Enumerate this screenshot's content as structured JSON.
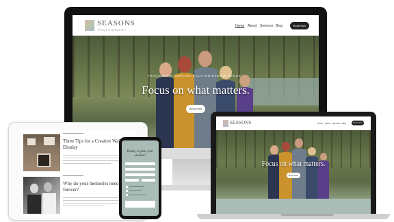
{
  "site": {
    "brand": "SEASONS",
    "brand_sub": "PHOTOGRAPHY",
    "nav": [
      "Home",
      "About",
      "Services",
      "Blog"
    ],
    "cta": "Book Now",
    "hero_small": "PHOTOGRAPHY SERVICES & CUSTOM WEBSITE DESIGN",
    "hero_title": "Focus on what matters.",
    "hero_button": "Book Now"
  },
  "tablet": {
    "post1_title": "Three Tips for a Creative Wall Display",
    "post2_title": "Why do your memories need to last forever?"
  },
  "phone": {
    "title": "Ready to plan your session?"
  },
  "colors": {
    "accent_sage": "#a9bcb6",
    "dark": "#222222"
  }
}
